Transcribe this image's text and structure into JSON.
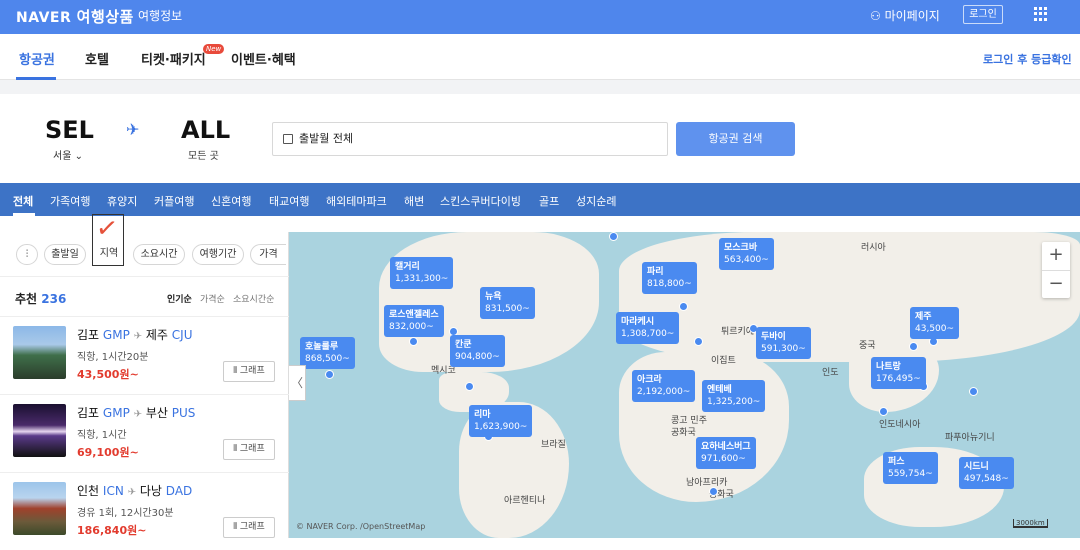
{
  "topbar": {
    "brand": "NAVER",
    "product": "여행상품",
    "info": "여행정보",
    "mypage": "마이페이지",
    "login": "로그인"
  },
  "tabs": {
    "items": [
      "항공권",
      "호텔",
      "티켓·패키지",
      "이벤트·혜택"
    ],
    "new_badge": "New",
    "login_grade": "로그인 후 등급확인"
  },
  "search": {
    "from_code": "SEL",
    "from_city": "서울",
    "to_code": "ALL",
    "to_city": "모든 곳",
    "date": "출발월 전체",
    "button": "항공권 검색"
  },
  "categories": [
    "전체",
    "가족여행",
    "휴양지",
    "커플여행",
    "신혼여행",
    "태교여행",
    "해외테마파크",
    "해변",
    "스킨스쿠버다이빙",
    "골프",
    "성지순례"
  ],
  "filters": {
    "chips": [
      "출발일",
      "지역",
      "소요시간",
      "여행기간",
      "가격"
    ]
  },
  "list": {
    "label": "추천",
    "count": "236",
    "sort": [
      "인기순",
      "가격순",
      "소요시간순"
    ],
    "graph_label": "그래프",
    "items": [
      {
        "from_city": "김포",
        "from_code": "GMP",
        "to_city": "제주",
        "to_code": "CJU",
        "detail": "직항, 1시간20분",
        "price": "43,500원~"
      },
      {
        "from_city": "김포",
        "from_code": "GMP",
        "to_city": "부산",
        "to_code": "PUS",
        "detail": "직항, 1시간",
        "price": "69,100원~"
      },
      {
        "from_city": "인천",
        "from_code": "ICN",
        "to_city": "다낭",
        "to_code": "DAD",
        "detail": "경유 1회, 12시간30분",
        "price": "186,840원~"
      }
    ]
  },
  "map": {
    "pins": [
      {
        "city": "모스크바",
        "price": "563,400~"
      },
      {
        "city": "파리",
        "price": "818,800~"
      },
      {
        "city": "캘거리",
        "price": "1,331,300~"
      },
      {
        "city": "뉴욕",
        "price": "831,500~"
      },
      {
        "city": "로스앤젤레스",
        "price": "832,000~"
      },
      {
        "city": "칸쿤",
        "price": "904,800~"
      },
      {
        "city": "호놀룰루",
        "price": "868,500~"
      },
      {
        "city": "마라케시",
        "price": "1,308,700~"
      },
      {
        "city": "두바이",
        "price": "591,300~"
      },
      {
        "city": "제주",
        "price": "43,500~"
      },
      {
        "city": "나트랑",
        "price": "176,495~"
      },
      {
        "city": "아크라",
        "price": "2,192,000~"
      },
      {
        "city": "엔테베",
        "price": "1,325,200~"
      },
      {
        "city": "리마",
        "price": "1,623,900~"
      },
      {
        "city": "요하네스버그",
        "price": "971,600~"
      },
      {
        "city": "퍼스",
        "price": "559,754~"
      },
      {
        "city": "시드니",
        "price": "497,548~"
      }
    ],
    "labels": [
      "러시아",
      "이집트",
      "중국",
      "인도",
      "인도네시아",
      "파푸아뉴기니",
      "브라질",
      "아르헨티나",
      "멕시코",
      "콩고 민주",
      "공화국",
      "남아프리카",
      "공화국",
      "튀르키예"
    ],
    "zoom_in": "+",
    "zoom_out": "−",
    "copyright": "© NAVER Corp. /OpenStreetMap",
    "scale": "3000km"
  }
}
